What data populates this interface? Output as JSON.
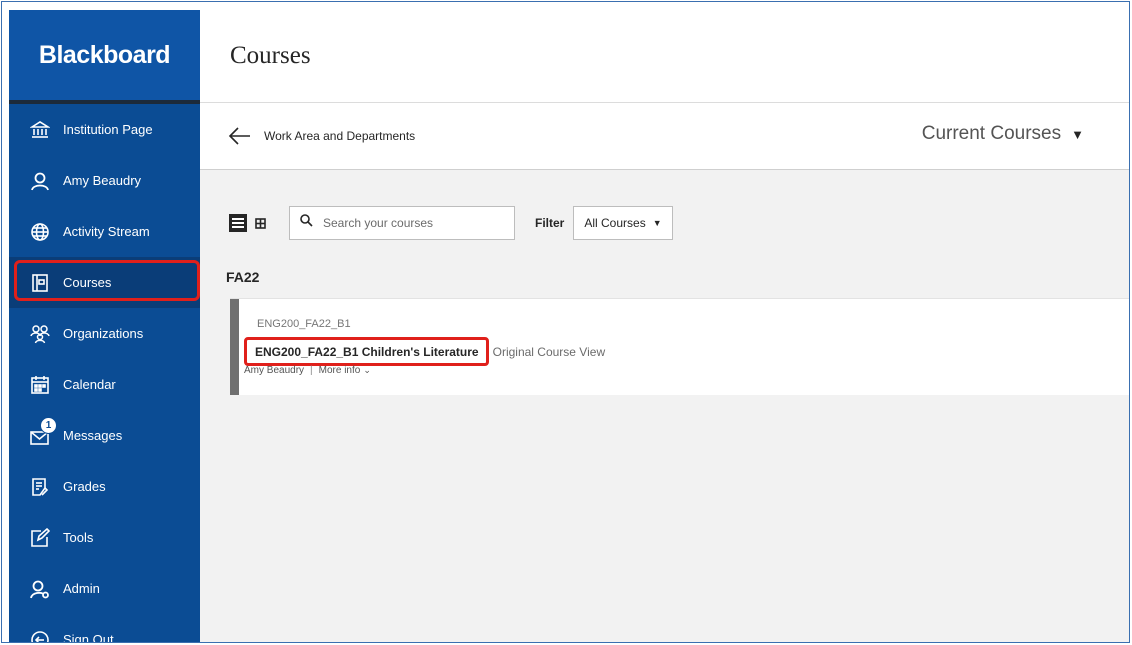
{
  "app": {
    "logo": "Blackboard"
  },
  "sidebar": {
    "items": [
      {
        "label": "Institution Page",
        "icon": "institution-icon"
      },
      {
        "label": "Amy Beaudry",
        "icon": "user-icon"
      },
      {
        "label": "Activity Stream",
        "icon": "globe-icon"
      },
      {
        "label": "Courses",
        "icon": "courses-icon",
        "active": true
      },
      {
        "label": "Organizations",
        "icon": "organizations-icon"
      },
      {
        "label": "Calendar",
        "icon": "calendar-icon"
      },
      {
        "label": "Messages",
        "icon": "messages-icon",
        "badge": "1"
      },
      {
        "label": "Grades",
        "icon": "grades-icon"
      },
      {
        "label": "Tools",
        "icon": "tools-icon"
      },
      {
        "label": "Admin",
        "icon": "admin-icon"
      },
      {
        "label": "Sign Out",
        "icon": "sign-out-icon"
      }
    ]
  },
  "header": {
    "title": "Courses"
  },
  "subbar": {
    "back_label": "Work Area and Departments",
    "term_selector": "Current Courses"
  },
  "toolbar": {
    "search_placeholder": "Search your courses",
    "filter_label": "Filter",
    "filter_value": "All Courses"
  },
  "term": "FA22",
  "course": {
    "id": "ENG200_FA22_B1",
    "name": "ENG200_FA22_B1 Children's Literature",
    "view": "Original Course View",
    "instructor": "Amy Beaudry",
    "more_info": "More info"
  },
  "colors": {
    "sidebar": "#0b4c94",
    "highlight": "#e0201b"
  }
}
